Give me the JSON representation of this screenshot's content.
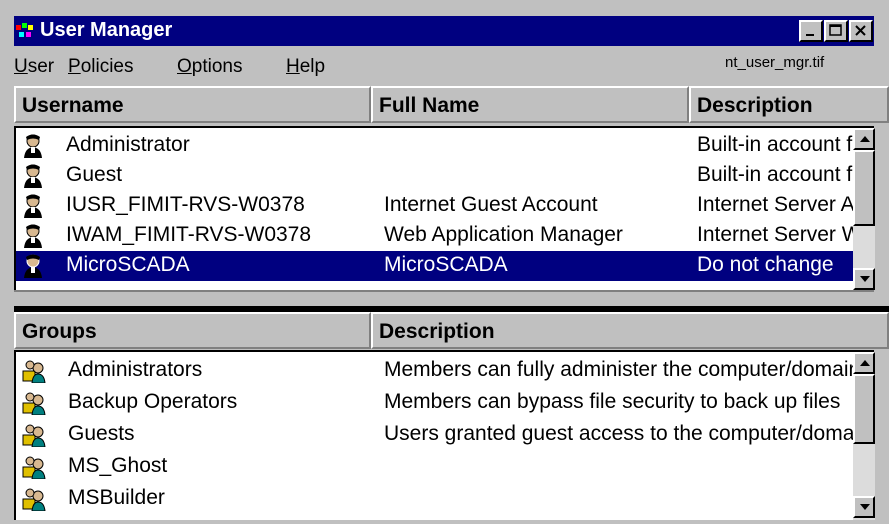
{
  "window": {
    "title": "User Manager",
    "filename": "nt_user_mgr.tif"
  },
  "menu": {
    "user": {
      "mnemonic": "U",
      "rest": "ser"
    },
    "policies": {
      "mnemonic": "P",
      "rest": "olicies"
    },
    "options": {
      "mnemonic": "O",
      "rest": "ptions"
    },
    "help": {
      "mnemonic": "H",
      "rest": "elp"
    }
  },
  "users": {
    "columns": [
      "Username",
      "Full Name",
      "Description"
    ],
    "rows": [
      {
        "username": "Administrator",
        "full_name": "",
        "description": "Built-in account for administering the computer/domain",
        "selected": false
      },
      {
        "username": "Guest",
        "full_name": "",
        "description": "Built-in account for guest access to the computer/domain",
        "selected": false
      },
      {
        "username": "IUSR_FIMIT-RVS-W0378",
        "full_name": "Internet Guest Account",
        "description": "Internet Server Anonymous Access",
        "selected": false
      },
      {
        "username": "IWAM_FIMIT-RVS-W0378",
        "full_name": "Web Application Manager",
        "description": "Internet Server Web Application Manager identity",
        "selected": false
      },
      {
        "username": "MicroSCADA",
        "full_name": "MicroSCADA",
        "description": "Do not change",
        "selected": true
      }
    ]
  },
  "groups": {
    "columns": [
      "Groups",
      "Description"
    ],
    "rows": [
      {
        "name": "Administrators",
        "description": "Members can fully administer the computer/domain"
      },
      {
        "name": "Backup Operators",
        "description": "Members can bypass file security to back up files"
      },
      {
        "name": "Guests",
        "description": "Users granted guest access to the computer/domain"
      },
      {
        "name": "MS_Ghost",
        "description": ""
      },
      {
        "name": "MSBuilder",
        "description": ""
      }
    ]
  },
  "colors": {
    "titlebar": "#000080",
    "selection": "#000080",
    "face": "#c0c0c0"
  },
  "icons": {
    "user_row": "user-icon",
    "group_row": "group-icon",
    "app": "user-manager-app-icon"
  }
}
